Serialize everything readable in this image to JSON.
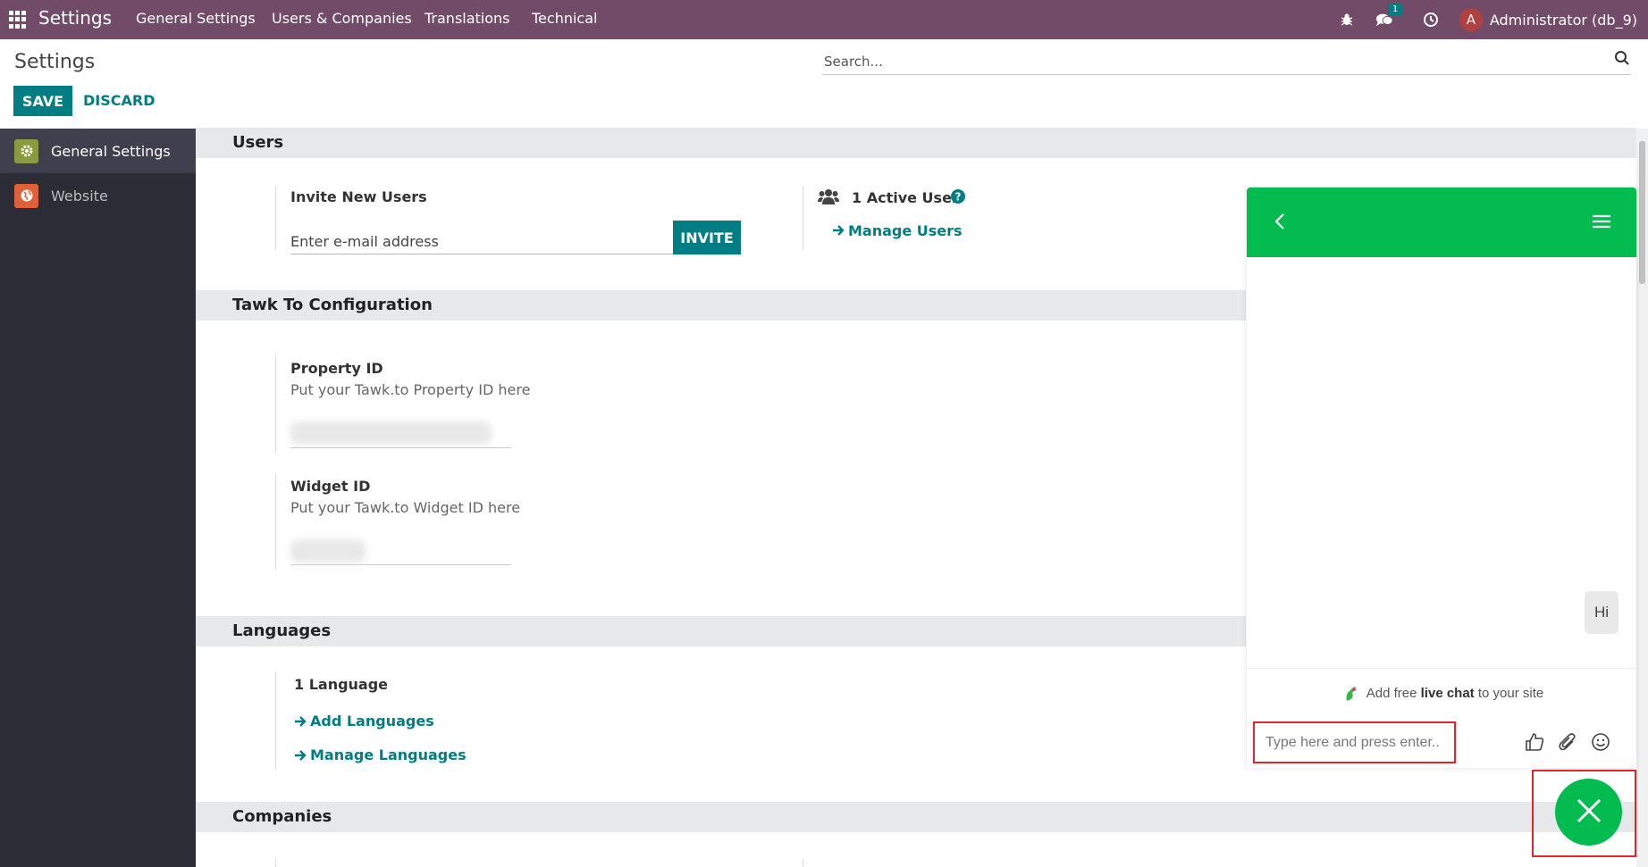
{
  "navbar": {
    "brand": "Settings",
    "menus": [
      "General Settings",
      "Users & Companies",
      "Translations",
      "Technical"
    ],
    "chat_badge": "1",
    "avatar_letter": "A",
    "user": "Administrator (db_9)"
  },
  "control_panel": {
    "title": "Settings",
    "save_label": "SAVE",
    "discard_label": "DISCARD",
    "search_placeholder": "Search..."
  },
  "sidebar": {
    "items": [
      {
        "label": "General Settings",
        "icon": "gear-icon",
        "active": true
      },
      {
        "label": "Website",
        "icon": "globe-icon",
        "active": false
      }
    ]
  },
  "sections": {
    "users": {
      "header": "Users",
      "invite_label": "Invite New Users",
      "email_placeholder": "Enter e-mail address",
      "invite_button": "INVITE",
      "active_users": "1 Active User",
      "manage_users": "Manage Users"
    },
    "tawk": {
      "header": "Tawk To Configuration",
      "property_label": "Property ID",
      "property_desc": "Put your Tawk.to Property ID here",
      "widget_label": "Widget ID",
      "widget_desc": "Put your Tawk.to Widget ID here"
    },
    "languages": {
      "header": "Languages",
      "count": "1 Language",
      "add": "Add Languages",
      "manage": "Manage Languages"
    },
    "companies": {
      "header": "Companies"
    }
  },
  "chat": {
    "message": "Hi",
    "promo_prefix": "Add free ",
    "promo_bold": "live chat",
    "promo_suffix": " to your site",
    "input_placeholder": "Type here and press enter.."
  },
  "colors": {
    "navbar": "#714B67",
    "accent": "#017e84",
    "chat_green": "#03BB4F",
    "highlight_red": "#e0262b"
  }
}
